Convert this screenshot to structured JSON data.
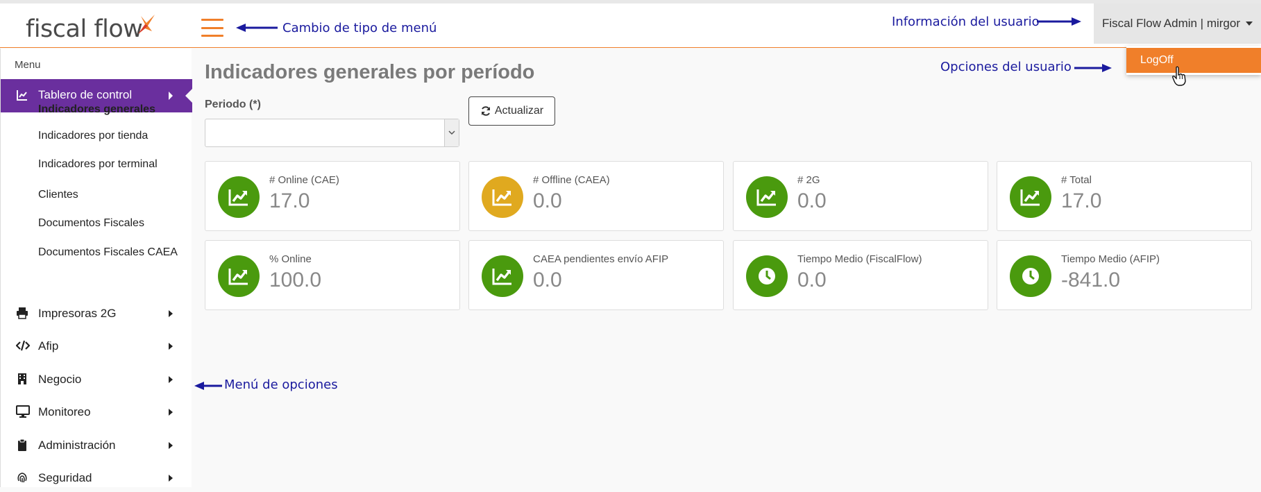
{
  "app": {
    "logo_text": "fiscal flow",
    "accent_color": "#f07f2a",
    "brand_purple": "#6a2f9e"
  },
  "header": {
    "user_label": "Fiscal Flow Admin | mirgor",
    "dropdown": {
      "logoff_label": "LogOff"
    }
  },
  "annotations": {
    "menu_type": "Cambio de tipo de menú",
    "user_info": "Información del usuario",
    "user_options": "Opciones del usuario",
    "options_menu": "Menú de opciones"
  },
  "sidebar": {
    "header": "Menu",
    "active": {
      "label": "Tablero de control",
      "icon": "chart-line-icon"
    },
    "subitems": [
      {
        "label": "Indicadores generales",
        "selected": true
      },
      {
        "label": "Indicadores por tienda"
      },
      {
        "label": "Indicadores por terminal"
      },
      {
        "label": "Clientes"
      },
      {
        "label": "Documentos Fiscales"
      },
      {
        "label": "Documentos Fiscales CAEA"
      }
    ],
    "items": [
      {
        "label": "Impresoras 2G",
        "icon": "printer-icon"
      },
      {
        "label": "Afip",
        "icon": "code-icon"
      },
      {
        "label": "Negocio",
        "icon": "building-icon"
      },
      {
        "label": "Monitoreo",
        "icon": "monitor-icon"
      },
      {
        "label": "Administración",
        "icon": "clipboard-icon"
      },
      {
        "label": "Seguridad",
        "icon": "fingerprint-icon"
      }
    ]
  },
  "main": {
    "title": "Indicadores generales por período",
    "periodo_label": "Periodo (*)",
    "periodo_value": "",
    "update_button": "Actualizar",
    "cards": [
      {
        "label": "# Online (CAE)",
        "value": "17.0",
        "icon": "chart-line-icon",
        "color": "#4a9a0e"
      },
      {
        "label": "# Offline (CAEA)",
        "value": "0.0",
        "icon": "chart-line-icon",
        "color": "#e0a91f"
      },
      {
        "label": "# 2G",
        "value": "0.0",
        "icon": "chart-line-icon",
        "color": "#4a9a0e"
      },
      {
        "label": "# Total",
        "value": "17.0",
        "icon": "chart-line-icon",
        "color": "#4a9a0e"
      },
      {
        "label": "% Online",
        "value": "100.0",
        "icon": "chart-line-icon",
        "color": "#4a9a0e"
      },
      {
        "label": "CAEA pendientes envío AFIP",
        "value": "0.0",
        "icon": "chart-line-icon",
        "color": "#4a9a0e"
      },
      {
        "label": "Tiempo Medio (FiscalFlow)",
        "value": "0.0",
        "icon": "clock-icon",
        "color": "#4a9a0e"
      },
      {
        "label": "Tiempo Medio (AFIP)",
        "value": "-841.0",
        "icon": "clock-icon",
        "color": "#4a9a0e"
      }
    ]
  }
}
